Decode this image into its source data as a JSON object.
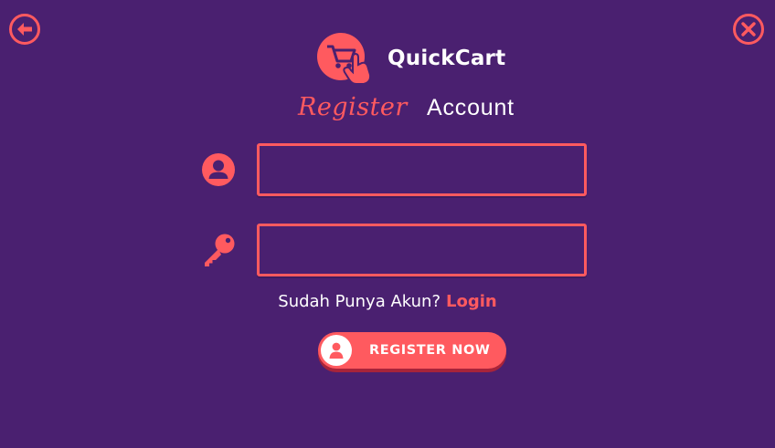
{
  "colors": {
    "background": "#4a2070",
    "accent": "#ff5a5f",
    "text": "#ffffff"
  },
  "nav": {
    "back_icon": "arrow-left-circle-icon",
    "close_icon": "close-circle-icon"
  },
  "brand": {
    "logo_icon": "shopping-cart-tap-icon",
    "name": "QuickCart"
  },
  "heading": {
    "register": "Register",
    "account": "Account"
  },
  "form": {
    "username": {
      "icon": "user-avatar-icon",
      "value": "",
      "placeholder": ""
    },
    "password": {
      "icon": "key-icon",
      "value": "",
      "placeholder": ""
    }
  },
  "login_prompt": {
    "text": "Sudah Punya Akun?",
    "link": "Login"
  },
  "register_button": {
    "icon": "user-icon",
    "label": "REGISTER NOW"
  }
}
